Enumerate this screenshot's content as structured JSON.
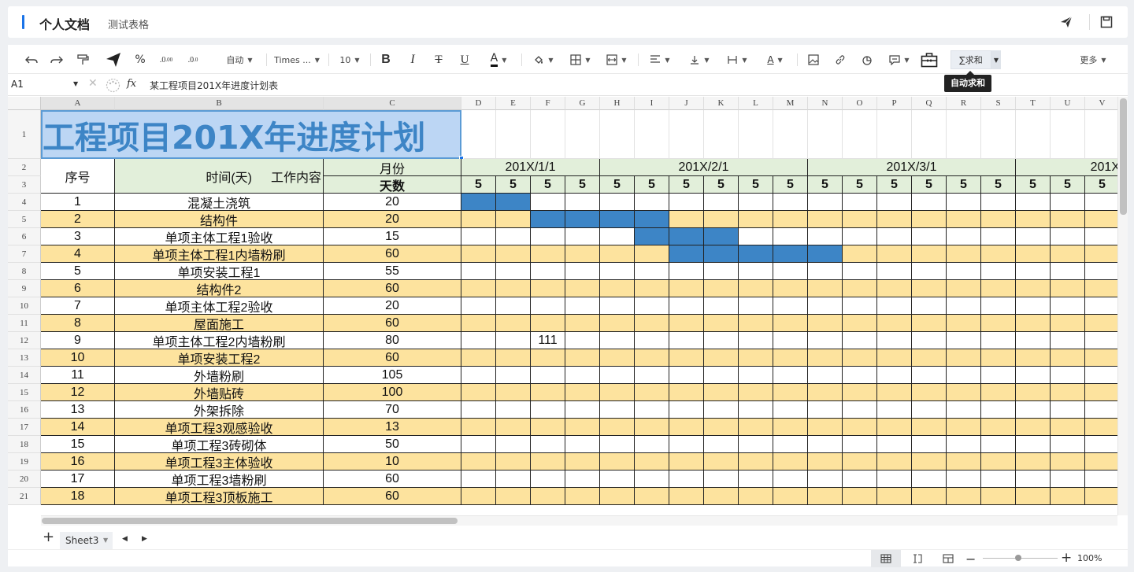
{
  "header": {
    "title": "个人文档",
    "subtitle": "测试表格"
  },
  "toolbar": {
    "font_size_auto": "自动",
    "font_name": "Times ...",
    "font_size": "10",
    "bold": "B",
    "italic": "I",
    "strike": "T",
    "underline": "U",
    "font_color": "A",
    "sum_label": "∑求和",
    "more_label": "更多",
    "tooltip": "自动求和"
  },
  "formula_bar": {
    "cell_ref": "A1",
    "fx": "fx",
    "content": "某工程项目201X年进度计划表"
  },
  "columns": [
    "A",
    "B",
    "C",
    "D",
    "E",
    "F",
    "G",
    "H",
    "I",
    "J",
    "K",
    "L",
    "M",
    "N",
    "O",
    "P",
    "Q",
    "R",
    "S",
    "T",
    "U",
    "V"
  ],
  "rows": [
    "1",
    "2",
    "3",
    "4",
    "5",
    "6",
    "7",
    "8",
    "9",
    "10",
    "11",
    "12",
    "13",
    "14",
    "15",
    "16",
    "17",
    "18",
    "19",
    "20",
    "21"
  ],
  "sheet": {
    "title": "工程项目201X年进度计划",
    "header_seq": "序号",
    "header_time": "时间(天)",
    "header_content": "工作内容",
    "header_month": "月份",
    "header_days": "天数",
    "months": [
      "201X/1/1",
      "201X/2/1",
      "201X/3/1",
      "201X"
    ],
    "five": "5",
    "tasks": [
      {
        "seq": "1",
        "name": "混凝土浇筑",
        "days": "20"
      },
      {
        "seq": "2",
        "name": "结构件",
        "days": "20"
      },
      {
        "seq": "3",
        "name": "单项主体工程1验收",
        "days": "15"
      },
      {
        "seq": "4",
        "name": "单项主体工程1内墙粉刷",
        "days": "60"
      },
      {
        "seq": "5",
        "name": "单项安装工程1",
        "days": "55"
      },
      {
        "seq": "6",
        "name": "结构件2",
        "days": "60"
      },
      {
        "seq": "7",
        "name": "单项主体工程2验收",
        "days": "20"
      },
      {
        "seq": "8",
        "name": "屋面施工",
        "days": "60"
      },
      {
        "seq": "9",
        "name": "单项主体工程2内墙粉刷",
        "days": "80"
      },
      {
        "seq": "10",
        "name": "单项安装工程2",
        "days": "60"
      },
      {
        "seq": "11",
        "name": "外墙粉刷",
        "days": "105"
      },
      {
        "seq": "12",
        "name": "外墙贴砖",
        "days": "100"
      },
      {
        "seq": "13",
        "name": "外架拆除",
        "days": "70"
      },
      {
        "seq": "14",
        "name": "单项工程3观感验收",
        "days": "13"
      },
      {
        "seq": "15",
        "name": "单项工程3砖砌体",
        "days": "50"
      },
      {
        "seq": "16",
        "name": "单项工程3主体验收",
        "days": "10"
      },
      {
        "seq": "17",
        "name": "单项工程3墙粉刷",
        "days": "60"
      },
      {
        "seq": "18",
        "name": "单项工程3顶板施工",
        "days": "60"
      }
    ],
    "extra_value": "111"
  },
  "sheet_tabs": {
    "active": "Sheet3"
  },
  "status": {
    "zoom": "100%"
  },
  "colors": {
    "accent": "#1a73e8",
    "gantt_blue": "#3d85c6",
    "row_yellow": "#fde39e",
    "header_green": "#e2efda",
    "title_fill": "#bcd6f4"
  }
}
